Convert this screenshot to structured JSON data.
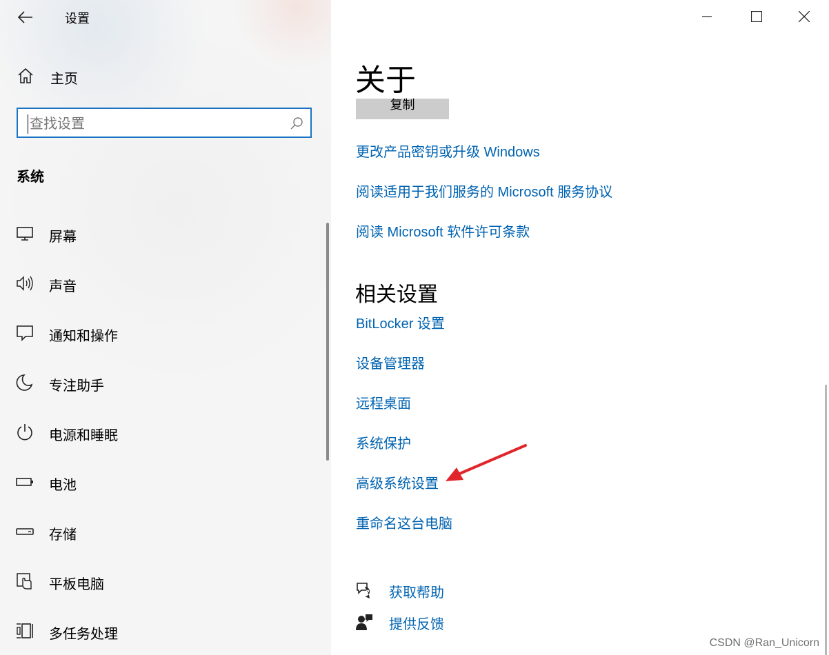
{
  "window": {
    "title": "设置",
    "controls": [
      "minimize",
      "maximize",
      "close"
    ]
  },
  "sidebar": {
    "home_label": "主页",
    "search": {
      "placeholder": "查找设置",
      "value": ""
    },
    "section_title": "系统",
    "items": [
      {
        "label": "屏幕",
        "icon": "monitor-icon"
      },
      {
        "label": "声音",
        "icon": "speaker-icon"
      },
      {
        "label": "通知和操作",
        "icon": "notification-icon"
      },
      {
        "label": "专注助手",
        "icon": "moon-icon"
      },
      {
        "label": "电源和睡眠",
        "icon": "power-icon"
      },
      {
        "label": "电池",
        "icon": "battery-icon"
      },
      {
        "label": "存储",
        "icon": "storage-icon"
      },
      {
        "label": "平板电脑",
        "icon": "tablet-icon"
      },
      {
        "label": "多任务处理",
        "icon": "multitask-icon"
      }
    ]
  },
  "main": {
    "page_title": "关于",
    "copy_button": "复制",
    "links": [
      "更改产品密钥或升级 Windows",
      "阅读适用于我们服务的 Microsoft 服务协议",
      "阅读 Microsoft 软件许可条款"
    ],
    "related_title": "相关设置",
    "related_links": [
      "BitLocker 设置",
      "设备管理器",
      "远程桌面",
      "系统保护",
      "高级系统设置",
      "重命名这台电脑"
    ],
    "help": [
      {
        "label": "获取帮助",
        "icon": "help-chat-icon"
      },
      {
        "label": "提供反馈",
        "icon": "feedback-icon"
      }
    ]
  },
  "annotation": {
    "arrow_color": "#e0262b"
  },
  "watermark": "CSDN @Ran_Unicorn",
  "colors": {
    "accent": "#0063b1",
    "search_border": "#1a73c4",
    "sidebar_bg": "#f5f5f5"
  }
}
